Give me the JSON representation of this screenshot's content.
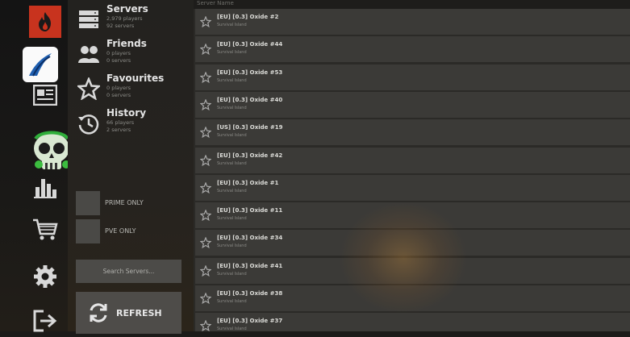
{
  "menu": {
    "servers": {
      "title": "Servers",
      "players": "2,979 players",
      "count": "92 servers"
    },
    "friends": {
      "title": "Friends",
      "players": "0 players",
      "count": "0 servers"
    },
    "favourites": {
      "title": "Favourites",
      "players": "0 players",
      "count": "0 servers"
    },
    "history": {
      "title": "History",
      "players": "66 players",
      "count": "2 servers"
    },
    "prime_only": "PRIME ONLY",
    "pve_only": "PVE ONLY",
    "search_placeholder": "Search Servers...",
    "refresh": "REFRESH"
  },
  "list": {
    "header": "Server Name",
    "rows": [
      {
        "name": "[EU] [0.3] Oxide #2",
        "sub": "Survival Island"
      },
      {
        "name": "[EU] [0.3] Oxide #44",
        "sub": "Survival Island"
      },
      {
        "name": "[EU] [0.3] Oxide #53",
        "sub": "Survival Island"
      },
      {
        "name": "[EU] [0.3] Oxide #40",
        "sub": "Survival Island"
      },
      {
        "name": "[US] [0.3] Oxide #19",
        "sub": "Survival Island"
      },
      {
        "name": "[EU] [0.3] Oxide #42",
        "sub": "Survival Island"
      },
      {
        "name": "[EU] [0.3] Oxide #1",
        "sub": "Survival Island"
      },
      {
        "name": "[EU] [0.3] Oxide #11",
        "sub": "Survival Island"
      },
      {
        "name": "[EU] [0.3] Oxide #34",
        "sub": "Survival Island"
      },
      {
        "name": "[EU] [0.3] Oxide #41",
        "sub": "Survival Island"
      },
      {
        "name": "[EU] [0.3] Oxide #38",
        "sub": "Survival Island"
      },
      {
        "name": "[EU] [0.3] Oxide #37",
        "sub": "Survival Island"
      }
    ]
  },
  "colors": {
    "accent": "#c8331e",
    "row_bg": "#3b3a37",
    "panel_bg": "#23221f"
  },
  "icons": [
    "flame-icon",
    "game-logo-icon",
    "news-icon",
    "skull-icon",
    "stats-icon",
    "cart-icon",
    "gear-icon",
    "exit-icon",
    "servers-icon",
    "friends-icon",
    "star-icon",
    "history-icon",
    "refresh-icon"
  ]
}
